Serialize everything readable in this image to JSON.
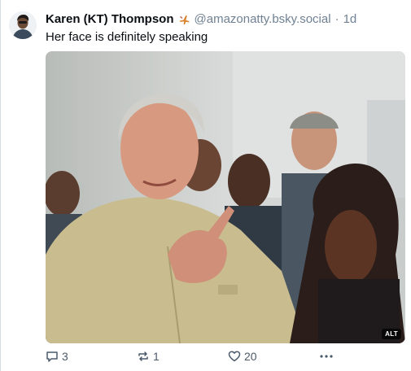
{
  "post": {
    "author": {
      "display_name": "Karen (KT) Thompson",
      "handle": "@amazonatty.bsky.social",
      "badge_icon": "airplane-icon"
    },
    "separator": "·",
    "timestamp": "1d",
    "text": "Her face is definitely speaking",
    "media": {
      "alt_badge": "ALT"
    },
    "actions": {
      "reply_count": "3",
      "repost_count": "1",
      "like_count": "20",
      "more_icon": "ellipsis-icon"
    }
  },
  "colors": {
    "text_primary": "#0b0f14",
    "text_secondary": "#6f8193",
    "action_color": "#4a5a6b",
    "border": "#d4dbe2"
  }
}
